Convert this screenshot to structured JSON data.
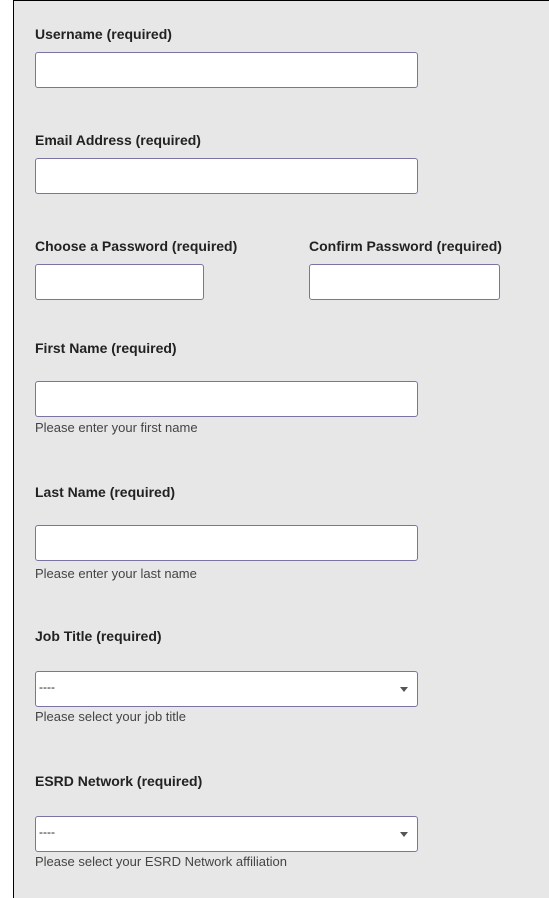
{
  "form": {
    "username": {
      "label": "Username (required)",
      "value": "",
      "placeholder": ""
    },
    "email": {
      "label": "Email Address (required)",
      "value": "",
      "placeholder": ""
    },
    "password": {
      "label": "Choose a Password (required)",
      "value": ""
    },
    "confirm_password": {
      "label": "Confirm Password (required)",
      "value": ""
    },
    "first_name": {
      "label": "First Name (required)",
      "value": "",
      "help": "Please enter your first name"
    },
    "last_name": {
      "label": "Last Name (required)",
      "value": "",
      "help": "Please enter your last name"
    },
    "job_title": {
      "label": "Job Title (required)",
      "selected": "----",
      "help": "Please select your job title",
      "icon": "chevron-down-icon"
    },
    "esrd_network": {
      "label": "ESRD Network (required)",
      "selected": "----",
      "help": "Please select your ESRD Network affiliation",
      "icon": "chevron-down-icon"
    }
  },
  "colors": {
    "panel_background": "#e7e7e7",
    "field_border": "#7a74a3",
    "label_text": "#222222",
    "help_text": "#444444"
  }
}
